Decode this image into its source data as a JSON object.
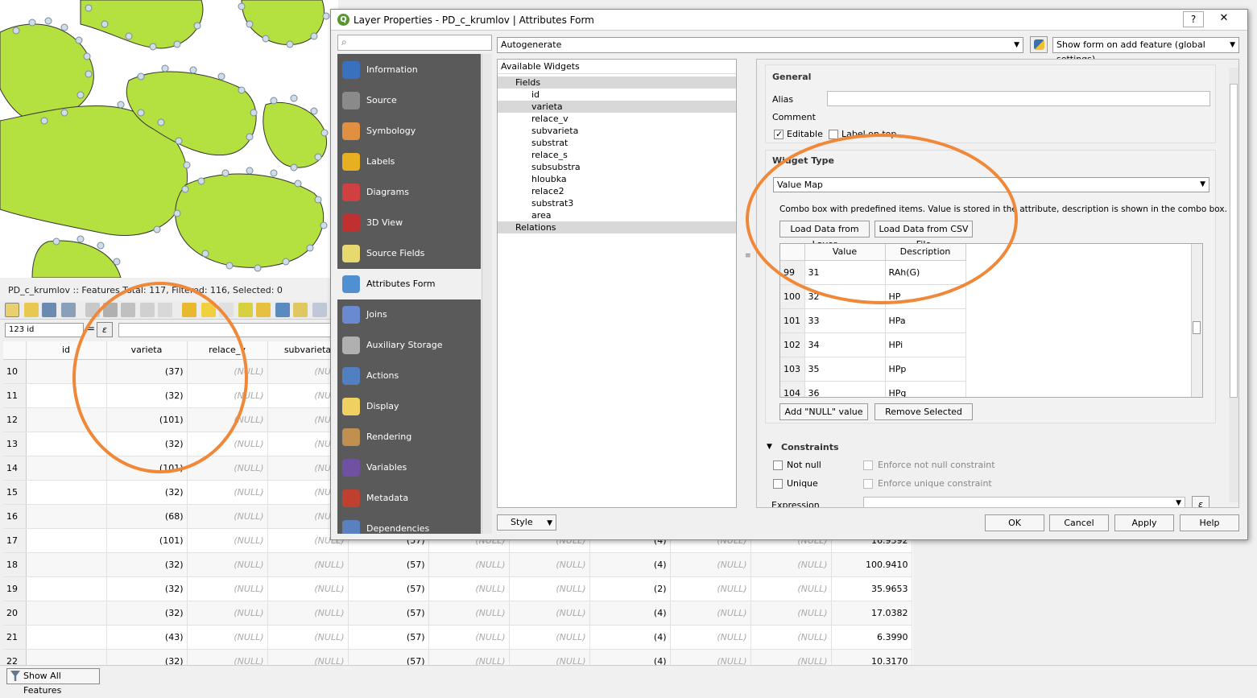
{
  "attr_table": {
    "title": "PD_c_krumlov :: Features Total: 117, Filtered: 116, Selected: 0",
    "field_combo": "123 id",
    "equals": "=",
    "expr_icon": "ε",
    "columns": [
      "id",
      "varieta",
      "relace_v",
      "subvarieta"
    ],
    "rows": [
      {
        "n": "10",
        "varieta": "(37)",
        "relace": "(NULL)",
        "sub": "(NULL)",
        "c5": "",
        "c6": "",
        "c7": "",
        "c8": "",
        "c9": "",
        "c10": "",
        "c11": ""
      },
      {
        "n": "11",
        "varieta": "(32)",
        "relace": "(NULL)",
        "sub": "(NULL)",
        "c5": "",
        "c6": "",
        "c7": "",
        "c8": "",
        "c9": "",
        "c10": "",
        "c11": ""
      },
      {
        "n": "12",
        "varieta": "(101)",
        "relace": "(NULL)",
        "sub": "(NULL)",
        "c5": "",
        "c6": "",
        "c7": "",
        "c8": "",
        "c9": "",
        "c10": "",
        "c11": ""
      },
      {
        "n": "13",
        "varieta": "(32)",
        "relace": "(NULL)",
        "sub": "(NULL)",
        "c5": "",
        "c6": "",
        "c7": "",
        "c8": "",
        "c9": "",
        "c10": "",
        "c11": ""
      },
      {
        "n": "14",
        "varieta": "(101)",
        "relace": "(NULL)",
        "sub": "(NULL)",
        "c5": "",
        "c6": "",
        "c7": "",
        "c8": "",
        "c9": "",
        "c10": "",
        "c11": ""
      },
      {
        "n": "15",
        "varieta": "(32)",
        "relace": "(NULL)",
        "sub": "(NULL)",
        "c5": "",
        "c6": "",
        "c7": "",
        "c8": "",
        "c9": "",
        "c10": "",
        "c11": ""
      },
      {
        "n": "16",
        "varieta": "(68)",
        "relace": "(NULL)",
        "sub": "(NULL)",
        "c5": "",
        "c6": "",
        "c7": "",
        "c8": "",
        "c9": "",
        "c10": "",
        "c11": ""
      },
      {
        "n": "17",
        "varieta": "(101)",
        "relace": "(NULL)",
        "sub": "(NULL)",
        "c5": "(57)",
        "c6": "(NULL)",
        "c7": "(NULL)",
        "c8": "(4)",
        "c9": "(NULL)",
        "c10": "(NULL)",
        "c11": "16.9392"
      },
      {
        "n": "18",
        "varieta": "(32)",
        "relace": "(NULL)",
        "sub": "(NULL)",
        "c5": "(57)",
        "c6": "(NULL)",
        "c7": "(NULL)",
        "c8": "(4)",
        "c9": "(NULL)",
        "c10": "(NULL)",
        "c11": "100.9410"
      },
      {
        "n": "19",
        "varieta": "(32)",
        "relace": "(NULL)",
        "sub": "(NULL)",
        "c5": "(57)",
        "c6": "(NULL)",
        "c7": "(NULL)",
        "c8": "(2)",
        "c9": "(NULL)",
        "c10": "(NULL)",
        "c11": "35.9653"
      },
      {
        "n": "20",
        "varieta": "(32)",
        "relace": "(NULL)",
        "sub": "(NULL)",
        "c5": "(57)",
        "c6": "(NULL)",
        "c7": "(NULL)",
        "c8": "(4)",
        "c9": "(NULL)",
        "c10": "(NULL)",
        "c11": "17.0382"
      },
      {
        "n": "21",
        "varieta": "(43)",
        "relace": "(NULL)",
        "sub": "(NULL)",
        "c5": "(57)",
        "c6": "(NULL)",
        "c7": "(NULL)",
        "c8": "(4)",
        "c9": "(NULL)",
        "c10": "(NULL)",
        "c11": "6.3990"
      },
      {
        "n": "22",
        "varieta": "(32)",
        "relace": "(NULL)",
        "sub": "(NULL)",
        "c5": "(57)",
        "c6": "(NULL)",
        "c7": "(NULL)",
        "c8": "(4)",
        "c9": "(NULL)",
        "c10": "(NULL)",
        "c11": "10.3170"
      }
    ],
    "show_all": "Show All Features"
  },
  "dialog": {
    "title": "Layer Properties - PD_c_krumlov | Attributes Form",
    "help": "?",
    "close": "✕",
    "nav": [
      "Information",
      "Source",
      "Symbology",
      "Labels",
      "Diagrams",
      "3D View",
      "Source Fields",
      "Attributes Form",
      "Joins",
      "Auxiliary Storage",
      "Actions",
      "Display",
      "Rendering",
      "Variables",
      "Metadata",
      "Dependencies"
    ],
    "autogenerate": "Autogenerate",
    "show_form": "Show form on add feature (global settings)",
    "available_widgets": "Available Widgets",
    "fields_label": "Fields",
    "fields": [
      "id",
      "varieta",
      "relace_v",
      "subvarieta",
      "substrat",
      "relace_s",
      "subsubstra",
      "hloubka",
      "relace2",
      "substrat3",
      "area"
    ],
    "relations_label": "Relations",
    "style_btn": "Style",
    "general": {
      "title": "General",
      "alias": "Alias",
      "comment": "Comment",
      "editable": "Editable",
      "label_on_top": "Label on top"
    },
    "widget_type": {
      "title": "Widget Type",
      "value": "Value Map",
      "description": "Combo box with predefined items. Value is stored in the attribute, description is shown in the combo box.",
      "load_layer": "Load Data from Layer",
      "load_csv": "Load Data from CSV File",
      "col_value": "Value",
      "col_desc": "Description",
      "rows": [
        {
          "n": "99",
          "v": "31",
          "d": "RAh(G)"
        },
        {
          "n": "100",
          "v": "32",
          "d": "HP"
        },
        {
          "n": "101",
          "v": "33",
          "d": "HPa"
        },
        {
          "n": "102",
          "v": "34",
          "d": "HPi"
        },
        {
          "n": "103",
          "v": "35",
          "d": "HPp"
        },
        {
          "n": "104",
          "v": "36",
          "d": "HPg"
        }
      ],
      "add_null": "Add \"NULL\" value",
      "remove": "Remove Selected"
    },
    "constraints": {
      "title": "Constraints",
      "not_null": "Not null",
      "unique": "Unique",
      "enforce_not_null": "Enforce not null constraint",
      "enforce_unique": "Enforce unique constraint",
      "expression": "Expression"
    },
    "buttons": {
      "ok": "OK",
      "cancel": "Cancel",
      "apply": "Apply",
      "help": "Help"
    }
  },
  "colors": {
    "polygon_fill": "#b4e040",
    "annotation": "#f0883a",
    "nav_bg": "#5a5a5a"
  }
}
